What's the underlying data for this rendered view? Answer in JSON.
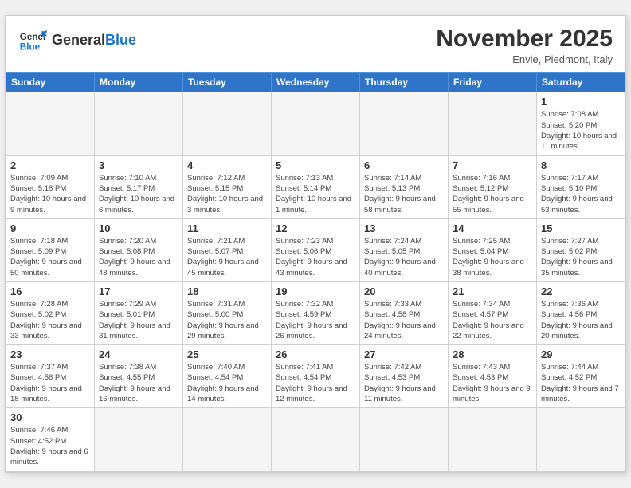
{
  "header": {
    "logo_general": "General",
    "logo_blue": "Blue",
    "month_title": "November 2025",
    "subtitle": "Envie, Piedmont, Italy"
  },
  "weekdays": [
    "Sunday",
    "Monday",
    "Tuesday",
    "Wednesday",
    "Thursday",
    "Friday",
    "Saturday"
  ],
  "weeks": [
    [
      {
        "day": "",
        "info": ""
      },
      {
        "day": "",
        "info": ""
      },
      {
        "day": "",
        "info": ""
      },
      {
        "day": "",
        "info": ""
      },
      {
        "day": "",
        "info": ""
      },
      {
        "day": "",
        "info": ""
      },
      {
        "day": "1",
        "info": "Sunrise: 7:08 AM\nSunset: 5:20 PM\nDaylight: 10 hours and 11 minutes."
      }
    ],
    [
      {
        "day": "2",
        "info": "Sunrise: 7:09 AM\nSunset: 5:18 PM\nDaylight: 10 hours and 9 minutes."
      },
      {
        "day": "3",
        "info": "Sunrise: 7:10 AM\nSunset: 5:17 PM\nDaylight: 10 hours and 6 minutes."
      },
      {
        "day": "4",
        "info": "Sunrise: 7:12 AM\nSunset: 5:15 PM\nDaylight: 10 hours and 3 minutes."
      },
      {
        "day": "5",
        "info": "Sunrise: 7:13 AM\nSunset: 5:14 PM\nDaylight: 10 hours and 1 minute."
      },
      {
        "day": "6",
        "info": "Sunrise: 7:14 AM\nSunset: 5:13 PM\nDaylight: 9 hours and 58 minutes."
      },
      {
        "day": "7",
        "info": "Sunrise: 7:16 AM\nSunset: 5:12 PM\nDaylight: 9 hours and 55 minutes."
      },
      {
        "day": "8",
        "info": "Sunrise: 7:17 AM\nSunset: 5:10 PM\nDaylight: 9 hours and 53 minutes."
      }
    ],
    [
      {
        "day": "9",
        "info": "Sunrise: 7:18 AM\nSunset: 5:09 PM\nDaylight: 9 hours and 50 minutes."
      },
      {
        "day": "10",
        "info": "Sunrise: 7:20 AM\nSunset: 5:08 PM\nDaylight: 9 hours and 48 minutes."
      },
      {
        "day": "11",
        "info": "Sunrise: 7:21 AM\nSunset: 5:07 PM\nDaylight: 9 hours and 45 minutes."
      },
      {
        "day": "12",
        "info": "Sunrise: 7:23 AM\nSunset: 5:06 PM\nDaylight: 9 hours and 43 minutes."
      },
      {
        "day": "13",
        "info": "Sunrise: 7:24 AM\nSunset: 5:05 PM\nDaylight: 9 hours and 40 minutes."
      },
      {
        "day": "14",
        "info": "Sunrise: 7:25 AM\nSunset: 5:04 PM\nDaylight: 9 hours and 38 minutes."
      },
      {
        "day": "15",
        "info": "Sunrise: 7:27 AM\nSunset: 5:02 PM\nDaylight: 9 hours and 35 minutes."
      }
    ],
    [
      {
        "day": "16",
        "info": "Sunrise: 7:28 AM\nSunset: 5:02 PM\nDaylight: 9 hours and 33 minutes."
      },
      {
        "day": "17",
        "info": "Sunrise: 7:29 AM\nSunset: 5:01 PM\nDaylight: 9 hours and 31 minutes."
      },
      {
        "day": "18",
        "info": "Sunrise: 7:31 AM\nSunset: 5:00 PM\nDaylight: 9 hours and 29 minutes."
      },
      {
        "day": "19",
        "info": "Sunrise: 7:32 AM\nSunset: 4:59 PM\nDaylight: 9 hours and 26 minutes."
      },
      {
        "day": "20",
        "info": "Sunrise: 7:33 AM\nSunset: 4:58 PM\nDaylight: 9 hours and 24 minutes."
      },
      {
        "day": "21",
        "info": "Sunrise: 7:34 AM\nSunset: 4:57 PM\nDaylight: 9 hours and 22 minutes."
      },
      {
        "day": "22",
        "info": "Sunrise: 7:36 AM\nSunset: 4:56 PM\nDaylight: 9 hours and 20 minutes."
      }
    ],
    [
      {
        "day": "23",
        "info": "Sunrise: 7:37 AM\nSunset: 4:56 PM\nDaylight: 9 hours and 18 minutes."
      },
      {
        "day": "24",
        "info": "Sunrise: 7:38 AM\nSunset: 4:55 PM\nDaylight: 9 hours and 16 minutes."
      },
      {
        "day": "25",
        "info": "Sunrise: 7:40 AM\nSunset: 4:54 PM\nDaylight: 9 hours and 14 minutes."
      },
      {
        "day": "26",
        "info": "Sunrise: 7:41 AM\nSunset: 4:54 PM\nDaylight: 9 hours and 12 minutes."
      },
      {
        "day": "27",
        "info": "Sunrise: 7:42 AM\nSunset: 4:53 PM\nDaylight: 9 hours and 11 minutes."
      },
      {
        "day": "28",
        "info": "Sunrise: 7:43 AM\nSunset: 4:53 PM\nDaylight: 9 hours and 9 minutes."
      },
      {
        "day": "29",
        "info": "Sunrise: 7:44 AM\nSunset: 4:52 PM\nDaylight: 9 hours and 7 minutes."
      }
    ],
    [
      {
        "day": "30",
        "info": "Sunrise: 7:46 AM\nSunset: 4:52 PM\nDaylight: 9 hours and 6 minutes."
      },
      {
        "day": "",
        "info": ""
      },
      {
        "day": "",
        "info": ""
      },
      {
        "day": "",
        "info": ""
      },
      {
        "day": "",
        "info": ""
      },
      {
        "day": "",
        "info": ""
      },
      {
        "day": "",
        "info": ""
      }
    ]
  ]
}
